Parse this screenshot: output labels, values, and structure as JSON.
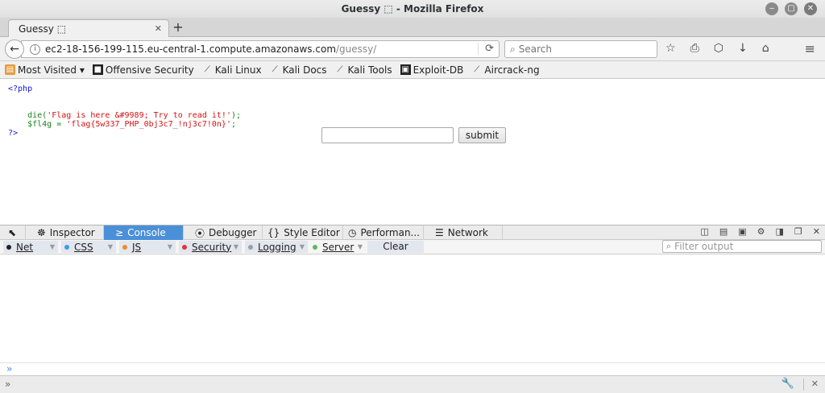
{
  "window": {
    "title": "Guessy ⬚ - Mozilla Firefox",
    "buttons": {
      "minimize": "‒",
      "maximize": "▢",
      "close": "✕"
    }
  },
  "tab": {
    "title": "Guessy ⬚",
    "close": "✕",
    "new_tab": "+"
  },
  "nav": {
    "back": "←",
    "info": "i",
    "url_host": "ec2-18-156-199-115.eu-central-1.compute.amazonaws.com",
    "url_path": "/guessy/",
    "reload": "⟳",
    "search_icon": "⌕",
    "search_placeholder": "Search",
    "icons": [
      "☆",
      "⎙",
      "⬡",
      "↓",
      "⌂"
    ],
    "menu": "≡"
  },
  "bookmarks": [
    {
      "label": "Most Visited ▾",
      "icon": "folder"
    },
    {
      "label": "Offensive Security",
      "icon": "dark"
    },
    {
      "label": "Kali Linux",
      "icon": "dragon"
    },
    {
      "label": "Kali Docs",
      "icon": "dragon"
    },
    {
      "label": "Kali Tools",
      "icon": "dragon"
    },
    {
      "label": "Exploit-DB",
      "icon": "dark"
    },
    {
      "label": "Aircrack-ng",
      "icon": "dragon"
    }
  ],
  "page": {
    "code": {
      "open_tag": "<?php",
      "die_fn": "die(",
      "die_arg": "'Flag is here &#9989; Try to read it!'",
      "die_end": ");",
      "var_name": "$fl4g",
      "assign": " = ",
      "var_value": "'flag{5w337_PHP_0bj3c7_!nj3c7!0n}'",
      "semi": ";",
      "close_tag": "?>"
    },
    "input_value": "",
    "submit_label": "submit"
  },
  "devtools": {
    "tabs": [
      {
        "icon": "☸",
        "label": "Inspector"
      },
      {
        "icon": "≥",
        "label": "Console"
      },
      {
        "icon": "⦿",
        "label": "Debugger"
      },
      {
        "icon": "{}",
        "label": "Style Editor"
      },
      {
        "icon": "◷",
        "label": "Performan..."
      },
      {
        "icon": "☰",
        "label": "Network"
      }
    ],
    "active_tab": "Console",
    "picker_icon": "⬉",
    "right_icons": [
      "◫",
      "▤",
      "▣",
      "⚙",
      "◨",
      "❐",
      "✕"
    ]
  },
  "console": {
    "filters": [
      {
        "label": "Net",
        "color": "#222222"
      },
      {
        "label": "CSS",
        "color": "#3b9ee6"
      },
      {
        "label": "JS",
        "color": "#f08c2c"
      },
      {
        "label": "Security",
        "color": "#e0353a"
      },
      {
        "label": "Logging",
        "color": "#9aa0a8"
      },
      {
        "label": "Server",
        "color": "#5fb85f"
      }
    ],
    "clear_label": "Clear",
    "filter_placeholder": "Filter output",
    "filter_icon": "⌕",
    "prompt": "»",
    "bottom_prompt": "»",
    "wrench": "🔧",
    "close": "✕"
  }
}
